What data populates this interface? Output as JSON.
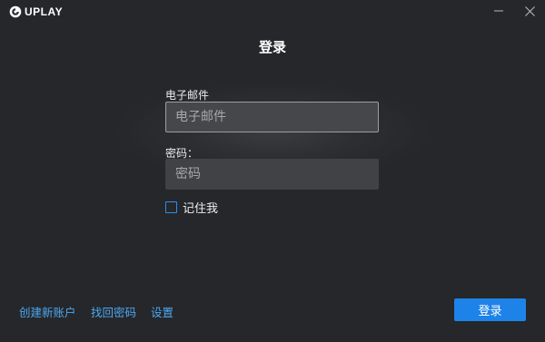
{
  "app": {
    "logo_text": "UPLAY",
    "logo_icon": "uplay-swirl-icon"
  },
  "window_controls": {
    "minimize_icon": "minimize-icon",
    "close_icon": "close-icon"
  },
  "login": {
    "title": "登录",
    "email_label": "电子邮件",
    "email_placeholder": "电子邮件",
    "email_value": "",
    "password_label": "密码：",
    "password_placeholder": "密码",
    "password_value": "",
    "remember_label": "记住我",
    "remember_checked": false,
    "submit_label": "登录"
  },
  "footer": {
    "create_account": "创建新账户",
    "recover_password": "找回密码",
    "settings": "设置"
  },
  "colors": {
    "background": "#26282b",
    "accent": "#1e83e9",
    "link": "#4ea7f2",
    "input_bg": "#45474b"
  }
}
